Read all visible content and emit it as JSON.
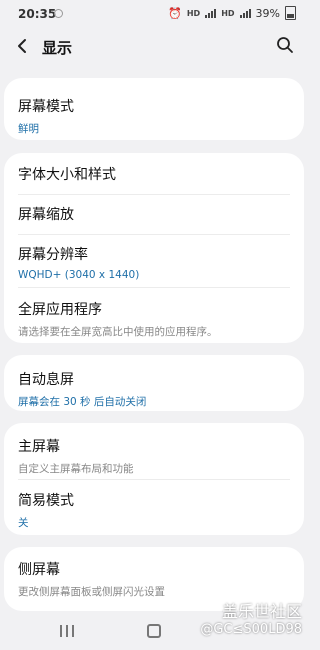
{
  "status_bar": {
    "time": "20:35",
    "battery": "39%",
    "net1": "HD",
    "net2": "HD"
  },
  "header": {
    "title": "显示"
  },
  "sections": {
    "screen_mode": {
      "title": "屏幕模式",
      "value": "鲜明"
    },
    "font": {
      "title": "字体大小和样式"
    },
    "zoom": {
      "title": "屏幕缩放"
    },
    "resolution": {
      "title": "屏幕分辨率",
      "value": "WQHD+ (3040 x 1440)"
    },
    "fullscreen": {
      "title": "全屏应用程序",
      "desc": "请选择要在全屏宽高比中使用的应用程序。"
    },
    "screen_timeout": {
      "title": "自动息屏",
      "value": "屏幕会在 30 秒 后自动关闭"
    },
    "home_screen": {
      "title": "主屏幕",
      "desc": "自定义主屏幕布局和功能"
    },
    "easy_mode": {
      "title": "简易模式",
      "value": "关"
    },
    "edge_screen": {
      "title": "侧屏幕",
      "desc": "更改侧屏幕面板或侧屏闪光设置"
    }
  },
  "watermark": {
    "line1": "盖乐世社区",
    "line2": "@GC≤S00LD98"
  },
  "colors": {
    "accent_value": "#1f6fa8",
    "background": "#f1f1f3",
    "card": "#ffffff"
  }
}
